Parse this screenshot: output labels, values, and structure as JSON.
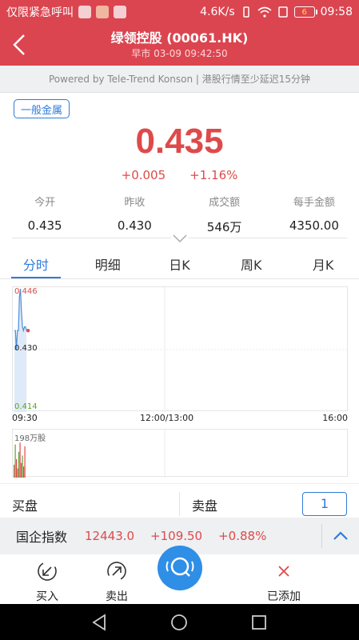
{
  "status_bar": {
    "carrier": "仅限紧急呼叫",
    "speed": "4.6K/s",
    "battery": "6",
    "time": "09:58"
  },
  "header": {
    "title": "绿领控股  (00061.HK)",
    "subtitle": "早市  03-09  09:42:50"
  },
  "powered": "Powered by Tele-Trend Konson | 港股行情至少延迟15分钟",
  "category_tag": "一般金属",
  "quote": {
    "price": "0.435",
    "change": "+0.005",
    "change_pct": "+1.16%"
  },
  "stats": [
    {
      "label": "今开",
      "value": "0.435"
    },
    {
      "label": "昨收",
      "value": "0.430"
    },
    {
      "label": "成交额",
      "value": "546万"
    },
    {
      "label": "每手金额",
      "value": "4350.00"
    }
  ],
  "tabs": [
    "分时",
    "明细",
    "日K",
    "周K",
    "月K"
  ],
  "chart": {
    "y_high": "0.446",
    "y_mid": "0.430",
    "y_low": "0.414",
    "x_start": "09:30",
    "x_mid": "12:00/13:00",
    "x_end": "16:00",
    "volume_label": "198万股"
  },
  "chart_data": {
    "type": "line",
    "x": [
      "09:30",
      "09:31",
      "09:32",
      "09:33",
      "09:34",
      "09:35",
      "09:36",
      "09:37",
      "09:38",
      "09:39",
      "09:40",
      "09:41",
      "09:42"
    ],
    "series": [
      {
        "values": [
          0.435,
          0.435,
          0.43,
          0.435,
          0.435,
          0.444,
          0.446,
          0.44,
          0.436,
          0.435,
          0.436,
          0.436,
          0.435
        ]
      }
    ],
    "volume": [
      0.35,
      0.9,
      0.5,
      0.25,
      0.7,
      0.95,
      0.4,
      0.6,
      0.3,
      0.85
    ],
    "ylim": [
      0.414,
      0.446
    ]
  },
  "order_book": {
    "bid_label": "买盘",
    "ask_label": "卖盘",
    "level": "1"
  },
  "index_bar": {
    "name": "国企指数",
    "value": "12443.0",
    "change": "+109.50",
    "change_pct": "+0.88%"
  },
  "toolbar": {
    "buy": "买入",
    "sell": "卖出",
    "added": "已添加"
  },
  "colors": {
    "brand": "#db4550",
    "up": "#de4a4a",
    "down": "#5fa031",
    "accent": "#2f7bd8"
  }
}
